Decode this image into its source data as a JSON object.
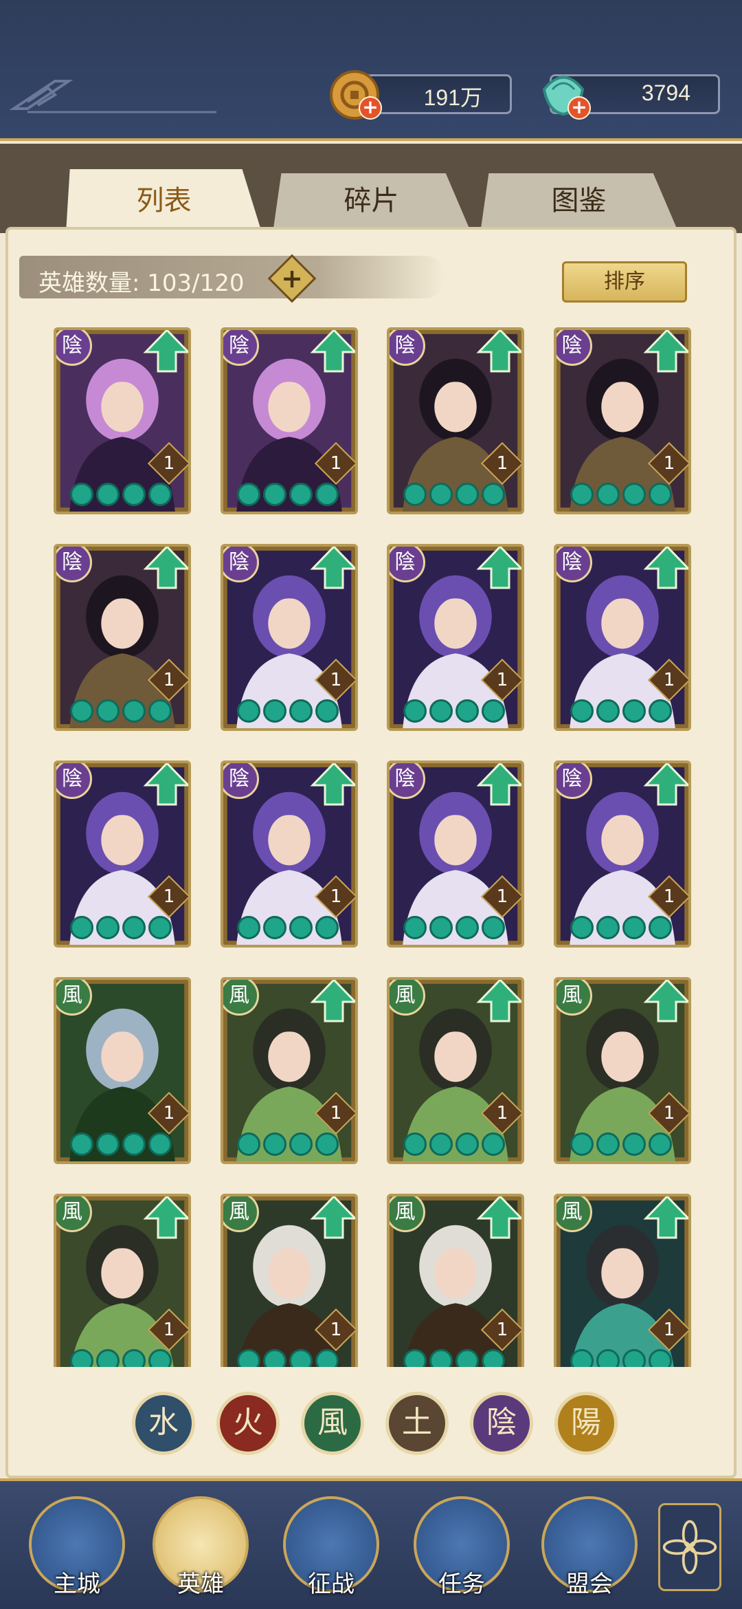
{
  "currency": {
    "coins": "191万",
    "gems": "3794"
  },
  "tabs": [
    {
      "label": "列表",
      "active": true
    },
    {
      "label": "碎片",
      "active": false
    },
    {
      "label": "图鉴",
      "active": false
    }
  ],
  "hero_count": {
    "label": "英雄数量: 103/120",
    "plus": "+"
  },
  "sort_button": "排序",
  "heroes": [
    {
      "element": "陰",
      "level": "1",
      "stars": 4,
      "upgrade": true,
      "color": "purple-pink"
    },
    {
      "element": "陰",
      "level": "1",
      "stars": 4,
      "upgrade": true,
      "color": "purple-pink"
    },
    {
      "element": "陰",
      "level": "1",
      "stars": 4,
      "upgrade": true,
      "color": "purple-dark"
    },
    {
      "element": "陰",
      "level": "1",
      "stars": 4,
      "upgrade": true,
      "color": "purple-dark"
    },
    {
      "element": "陰",
      "level": "1",
      "stars": 4,
      "upgrade": true,
      "color": "purple-dark"
    },
    {
      "element": "陰",
      "level": "1",
      "stars": 4,
      "upgrade": true,
      "color": "purple-mask"
    },
    {
      "element": "陰",
      "level": "1",
      "stars": 4,
      "upgrade": true,
      "color": "purple-mask"
    },
    {
      "element": "陰",
      "level": "1",
      "stars": 4,
      "upgrade": true,
      "color": "purple-mask"
    },
    {
      "element": "陰",
      "level": "1",
      "stars": 4,
      "upgrade": true,
      "color": "purple-mask"
    },
    {
      "element": "陰",
      "level": "1",
      "stars": 4,
      "upgrade": true,
      "color": "purple-mask"
    },
    {
      "element": "陰",
      "level": "1",
      "stars": 4,
      "upgrade": true,
      "color": "purple-mask"
    },
    {
      "element": "陰",
      "level": "1",
      "stars": 4,
      "upgrade": true,
      "color": "purple-mask"
    },
    {
      "element": "風",
      "level": "1",
      "stars": 4,
      "upgrade": false,
      "color": "green-silver"
    },
    {
      "element": "風",
      "level": "1",
      "stars": 4,
      "upgrade": true,
      "color": "green-lady"
    },
    {
      "element": "風",
      "level": "1",
      "stars": 4,
      "upgrade": true,
      "color": "green-lady"
    },
    {
      "element": "風",
      "level": "1",
      "stars": 4,
      "upgrade": true,
      "color": "green-lady"
    },
    {
      "element": "風",
      "level": "1",
      "stars": 4,
      "upgrade": true,
      "color": "green-lady"
    },
    {
      "element": "風",
      "level": "1",
      "stars": 4,
      "upgrade": true,
      "color": "green-warrior"
    },
    {
      "element": "風",
      "level": "1",
      "stars": 4,
      "upgrade": true,
      "color": "green-warrior"
    },
    {
      "element": "風",
      "level": "1",
      "stars": 4,
      "upgrade": true,
      "color": "green-teal"
    }
  ],
  "element_filters": [
    {
      "glyph": "水",
      "name": "water",
      "color": "#2f4f6a"
    },
    {
      "glyph": "火",
      "name": "fire",
      "color": "#8a2a20"
    },
    {
      "glyph": "風",
      "name": "wind",
      "color": "#2c6a44"
    },
    {
      "glyph": "土",
      "name": "earth",
      "color": "#5a4632"
    },
    {
      "glyph": "陰",
      "name": "yin",
      "color": "#5a3a7a"
    },
    {
      "glyph": "陽",
      "name": "yang",
      "color": "#b0801c"
    }
  ],
  "bottom_nav": [
    {
      "label": "主城",
      "icon": "castle-icon"
    },
    {
      "label": "英雄",
      "icon": "hero-icon",
      "active": true
    },
    {
      "label": "征战",
      "icon": "battle-icon"
    },
    {
      "label": "任务",
      "icon": "quest-icon"
    },
    {
      "label": "盟会",
      "icon": "guild-icon"
    }
  ],
  "colors": {
    "yin": "#6a3f8f",
    "wind": "#3b7b44",
    "upgrade": "#2fb07a",
    "star": "#1fa58a",
    "gold": "#c9a65a"
  }
}
